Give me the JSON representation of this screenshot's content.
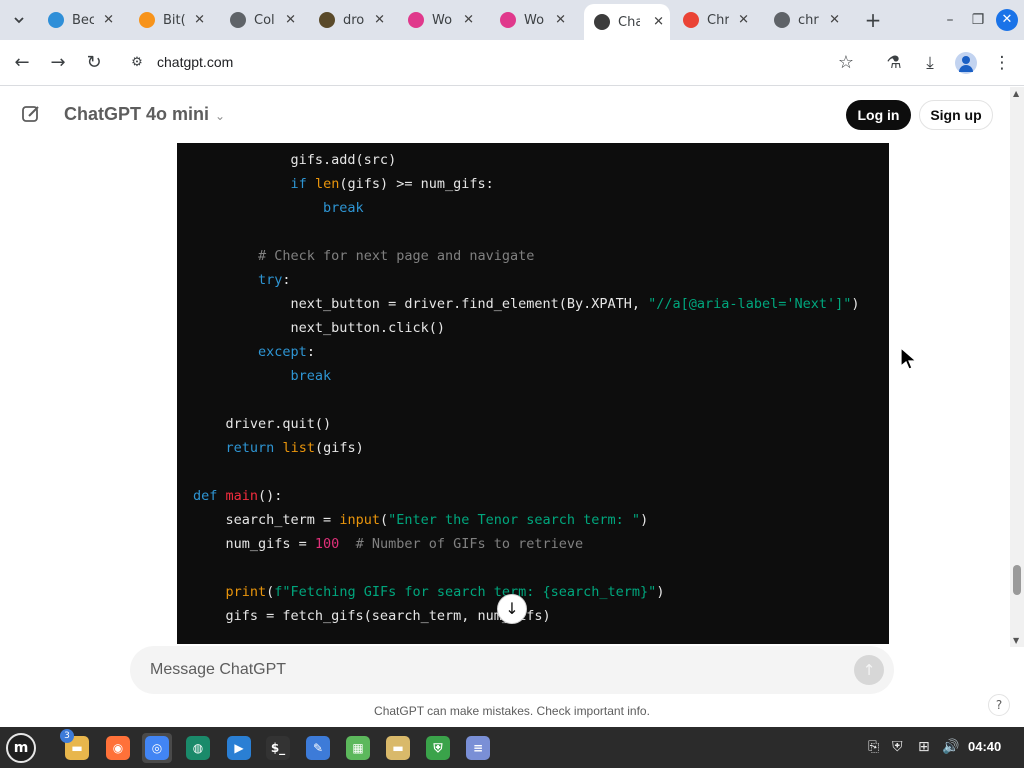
{
  "browser": {
    "tabs": [
      {
        "label": "Bec",
        "favicon": "edge-icon",
        "color": "#2f8fd8"
      },
      {
        "label": "Bit(",
        "favicon": "bitcoin-icon",
        "color": "#f7931a"
      },
      {
        "label": "Col",
        "favicon": "globe-icon",
        "color": "#5f6368"
      },
      {
        "label": "dro",
        "favicon": "book-icon",
        "color": "#5a4a2a"
      },
      {
        "label": "Wo",
        "favicon": "flower-icon",
        "color": "#e0398c"
      },
      {
        "label": "Wo",
        "favicon": "flower-icon",
        "color": "#e0398c"
      },
      {
        "label": "Cha",
        "favicon": "chatgpt-icon",
        "color": "#3c3c3c",
        "active": true
      },
      {
        "label": "Chr",
        "favicon": "google-icon",
        "color": "#ea4335"
      },
      {
        "label": "chr",
        "favicon": "globe-icon",
        "color": "#5f6368"
      }
    ],
    "url": "chatgpt.com"
  },
  "header": {
    "model": "ChatGPT 4o mini",
    "login": "Log in",
    "signup": "Sign up"
  },
  "code": {
    "lines": [
      [
        {
          "t": "            gifs.add(src)",
          "c": ""
        }
      ],
      [
        {
          "t": "            ",
          "c": ""
        },
        {
          "t": "if",
          "c": "kw"
        },
        {
          "t": " ",
          "c": ""
        },
        {
          "t": "len",
          "c": "bi"
        },
        {
          "t": "(gifs) >= num_gifs:",
          "c": ""
        }
      ],
      [
        {
          "t": "                ",
          "c": ""
        },
        {
          "t": "break",
          "c": "kw"
        }
      ],
      [
        {
          "t": "",
          "c": ""
        }
      ],
      [
        {
          "t": "        ",
          "c": ""
        },
        {
          "t": "# Check for next page and navigate",
          "c": "cm"
        }
      ],
      [
        {
          "t": "        ",
          "c": ""
        },
        {
          "t": "try",
          "c": "kw"
        },
        {
          "t": ":",
          "c": ""
        }
      ],
      [
        {
          "t": "            next_button = driver.find_element(By.XPATH, ",
          "c": ""
        },
        {
          "t": "\"//a[@aria-label='Next']\"",
          "c": "str"
        },
        {
          "t": ")",
          "c": ""
        }
      ],
      [
        {
          "t": "            next_button.click()",
          "c": ""
        }
      ],
      [
        {
          "t": "        ",
          "c": ""
        },
        {
          "t": "except",
          "c": "kw"
        },
        {
          "t": ":",
          "c": ""
        }
      ],
      [
        {
          "t": "            ",
          "c": ""
        },
        {
          "t": "break",
          "c": "kw"
        }
      ],
      [
        {
          "t": "",
          "c": ""
        }
      ],
      [
        {
          "t": "    driver.quit()",
          "c": ""
        }
      ],
      [
        {
          "t": "    ",
          "c": ""
        },
        {
          "t": "return",
          "c": "kw"
        },
        {
          "t": " ",
          "c": ""
        },
        {
          "t": "list",
          "c": "bi"
        },
        {
          "t": "(gifs)",
          "c": ""
        }
      ],
      [
        {
          "t": "",
          "c": ""
        }
      ],
      [
        {
          "t": "def",
          "c": "kw"
        },
        {
          "t": " ",
          "c": ""
        },
        {
          "t": "main",
          "c": "fn"
        },
        {
          "t": "():",
          "c": ""
        }
      ],
      [
        {
          "t": "    search_term = ",
          "c": ""
        },
        {
          "t": "input",
          "c": "bi"
        },
        {
          "t": "(",
          "c": ""
        },
        {
          "t": "\"Enter the Tenor search term: \"",
          "c": "str"
        },
        {
          "t": ")",
          "c": ""
        }
      ],
      [
        {
          "t": "    num_gifs = ",
          "c": ""
        },
        {
          "t": "100",
          "c": "num"
        },
        {
          "t": "  ",
          "c": ""
        },
        {
          "t": "# Number of GIFs to retrieve",
          "c": "cm"
        }
      ],
      [
        {
          "t": "",
          "c": ""
        }
      ],
      [
        {
          "t": "    ",
          "c": ""
        },
        {
          "t": "print",
          "c": "bi"
        },
        {
          "t": "(",
          "c": ""
        },
        {
          "t": "f\"Fetching GIFs for search term: {search_term}\"",
          "c": "str"
        },
        {
          "t": ")",
          "c": ""
        }
      ],
      [
        {
          "t": "    gifs = fetch_gifs(search_term, num_gifs)",
          "c": ""
        }
      ]
    ]
  },
  "composer": {
    "placeholder": "Message ChatGPT",
    "disclaimer": "ChatGPT can make mistakes. Check important info.",
    "help": "?"
  },
  "taskbar": {
    "badge": "3",
    "clock": "04:40",
    "apps": [
      {
        "name": "files-app-icon",
        "color": "#e8b64c"
      },
      {
        "name": "firefox-app-icon",
        "color": "#ff7139"
      },
      {
        "name": "chrome-app-icon",
        "color": "#4285f4",
        "active": true
      },
      {
        "name": "edge-dev-app-icon",
        "color": "#1a8a6a"
      },
      {
        "name": "remote-desktop-app-icon",
        "color": "#2a7fd4"
      },
      {
        "name": "terminal-app-icon",
        "color": "#333333"
      },
      {
        "name": "text-editor-app-icon",
        "color": "#3d7bd8"
      },
      {
        "name": "spreadsheet-app-icon",
        "color": "#5cb85c"
      },
      {
        "name": "folder-app-icon",
        "color": "#d9b96a"
      },
      {
        "name": "shield-app-icon",
        "color": "#3aa34a"
      },
      {
        "name": "notes-app-icon",
        "color": "#7a8fd6"
      }
    ]
  }
}
